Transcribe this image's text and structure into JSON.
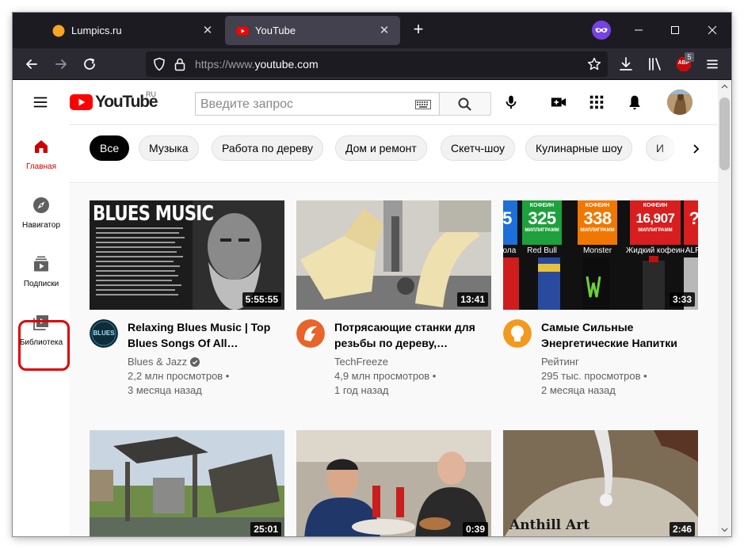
{
  "browser": {
    "tabs": [
      {
        "title": "Lumpics.ru",
        "active": false
      },
      {
        "title": "YouTube",
        "active": true
      }
    ],
    "url_scheme": "https://www.",
    "url_host": "youtube.com",
    "extension_badge": "5",
    "extension_label": "ABP"
  },
  "youtube": {
    "logo_word": "YouTube",
    "logo_country": "RU",
    "search_placeholder": "Введите запрос",
    "guide": [
      {
        "label": "Главная",
        "icon": "home-icon",
        "active": true
      },
      {
        "label": "Навигатор",
        "icon": "explore-icon",
        "active": false
      },
      {
        "label": "Подписки",
        "icon": "subscriptions-icon",
        "active": false
      },
      {
        "label": "Библиотека",
        "icon": "library-icon",
        "active": false
      }
    ],
    "chips": [
      "Все",
      "Музыка",
      "Работа по дереву",
      "Дом и ремонт",
      "Скетч-шоу",
      "Кулинарные шоу",
      "И"
    ],
    "videos": [
      {
        "title": "Relaxing Blues Music | Top Blues Songs Of All…",
        "channel": "Blues & Jazz",
        "verified": true,
        "views": "2,2 млн просмотров •",
        "age": "3 месяца назад",
        "duration": "5:55:55",
        "thumb_text": "BLUES MUSIC",
        "avatar_text": "BLUES"
      },
      {
        "title": "Потрясающие станки для резьбы по дереву,…",
        "channel": "TechFreeze",
        "verified": false,
        "views": "4,9 млн просмотров •",
        "age": "1 год назад",
        "duration": "13:41"
      },
      {
        "title": "Самые Сильные Энергетические Напитки",
        "channel": "Рейтинг",
        "verified": false,
        "views": "295 тыс. просмотров •",
        "age": "2 месяца назад",
        "duration": "3:33",
        "thumb_badges": [
          {
            "top": "",
            "num": "5",
            "name": "Кола"
          },
          {
            "top": "КОФЕИН",
            "num": "325",
            "name": "Red Bull"
          },
          {
            "top": "КОФЕИН",
            "num": "338",
            "name": "Monster"
          },
          {
            "top": "КОФЕИН",
            "num": "16,907",
            "name": "Жидкий кофеин"
          },
          {
            "top": "",
            "num": "?",
            "name": "ALRI"
          }
        ],
        "badge_sub": "МИЛЛИГРАММ"
      },
      {
        "title": "",
        "channel": "",
        "views": "",
        "age": "",
        "duration": "25:01"
      },
      {
        "title": "",
        "channel": "",
        "views": "",
        "age": "",
        "duration": "0:39"
      },
      {
        "title": "",
        "channel": "",
        "views": "",
        "age": "",
        "duration": "2:46",
        "thumb_text": "Anthill Art"
      }
    ]
  },
  "colors": {
    "yt_red": "#ff0000",
    "highlight_red": "#e00000",
    "badge_green": "#1ea03c",
    "badge_orange": "#f07800",
    "badge_red": "#d81e1e"
  }
}
